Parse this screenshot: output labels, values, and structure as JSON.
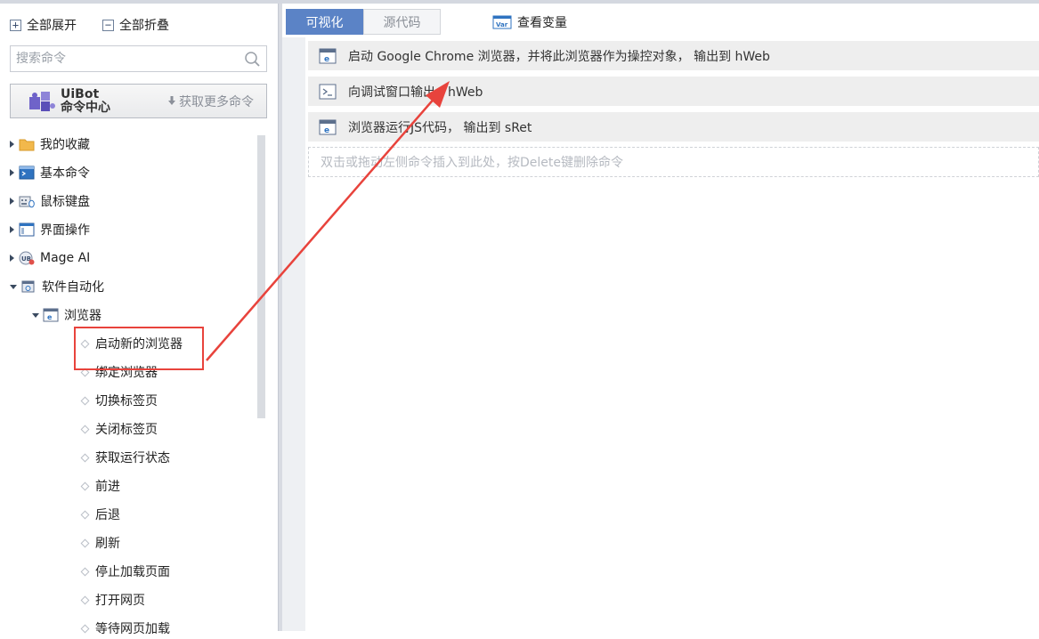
{
  "left": {
    "expand_all": "全部展开",
    "collapse_all": "全部折叠",
    "search_placeholder": "搜索命令",
    "command_center": {
      "line1": "UiBot",
      "line2": "命令中心",
      "more": "获取更多命令"
    },
    "tree": [
      {
        "label": "我的收藏",
        "icon": "folder-icon"
      },
      {
        "label": "基本命令",
        "icon": "terminal-icon"
      },
      {
        "label": "鼠标键盘",
        "icon": "keyboard-mouse-icon"
      },
      {
        "label": "界面操作",
        "icon": "window-icon"
      },
      {
        "label": "Mage AI",
        "icon": "mage-ai-icon"
      },
      {
        "label": "软件自动化",
        "icon": "software-automation-icon"
      },
      {
        "label": "浏览器",
        "icon": "browser-icon"
      }
    ],
    "browser_commands": [
      "启动新的浏览器",
      "绑定浏览器",
      "切换标签页",
      "关闭标签页",
      "获取运行状态",
      "前进",
      "后退",
      "刷新",
      "停止加载页面",
      "打开网页",
      "等待网页加载"
    ]
  },
  "right": {
    "tabs": [
      "可视化",
      "源代码"
    ],
    "view_vars": "查看变量",
    "commands": [
      "启动 Google Chrome 浏览器，并将此浏览器作为操控对象， 输出到 hWeb",
      "向调试窗口输出：hWeb",
      "浏览器运行JS代码， 输出到 sRet"
    ],
    "drop_hint": "双击或拖动左侧命令插入到此处，按Delete键删除命令"
  },
  "colors": {
    "active_tab": "#5b83c6",
    "highlight_box": "#e8433c",
    "row_bg": "#eeeeee"
  }
}
